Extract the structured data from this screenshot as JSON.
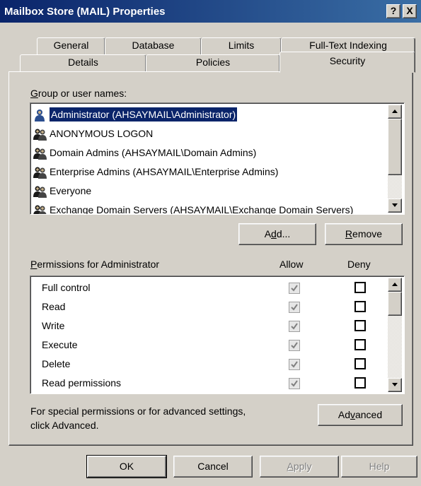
{
  "window": {
    "title": "Mailbox Store (MAIL) Properties",
    "help_btn": "?",
    "close_btn": "X"
  },
  "tabs_back": [
    "General",
    "Database",
    "Limits",
    "Full-Text Indexing"
  ],
  "tabs_front": [
    "Details",
    "Policies",
    "Security"
  ],
  "active_tab": "Security",
  "group_label": {
    "accel": "G",
    "rest": "roup or user names:"
  },
  "users": [
    {
      "name": "Administrator (AHSAYMAIL\\Administrator)",
      "selected": true,
      "icon": "user-icon"
    },
    {
      "name": "ANONYMOUS LOGON",
      "selected": false,
      "icon": "group-icon"
    },
    {
      "name": "Domain Admins (AHSAYMAIL\\Domain Admins)",
      "selected": false,
      "icon": "group-icon"
    },
    {
      "name": "Enterprise Admins (AHSAYMAIL\\Enterprise Admins)",
      "selected": false,
      "icon": "group-icon"
    },
    {
      "name": "Everyone",
      "selected": false,
      "icon": "group-icon"
    },
    {
      "name": "Exchange Domain Servers (AHSAYMAIL\\Exchange Domain Servers)",
      "selected": false,
      "icon": "group-icon"
    }
  ],
  "add_button": {
    "pre": "A",
    "accel": "d",
    "post": "d..."
  },
  "remove_button": {
    "accel": "R",
    "post": "emove"
  },
  "permissions_label": {
    "accel": "P",
    "rest": "ermissions for Administrator"
  },
  "allow_header": "Allow",
  "deny_header": "Deny",
  "permissions": [
    {
      "name": "Full control",
      "allow": true,
      "deny": false
    },
    {
      "name": "Read",
      "allow": true,
      "deny": false
    },
    {
      "name": "Write",
      "allow": true,
      "deny": false
    },
    {
      "name": "Execute",
      "allow": true,
      "deny": false
    },
    {
      "name": "Delete",
      "allow": true,
      "deny": false
    },
    {
      "name": "Read permissions",
      "allow": true,
      "deny": false
    }
  ],
  "advanced_text_1": "For special permissions or for advanced settings,",
  "advanced_text_2": "click Advanced.",
  "advanced_button": {
    "pre": "Ad",
    "accel": "v",
    "post": "anced"
  },
  "ok_button": "OK",
  "cancel_button": "Cancel",
  "apply_button": {
    "accel": "A",
    "post": "pply"
  },
  "help_button": "Help"
}
